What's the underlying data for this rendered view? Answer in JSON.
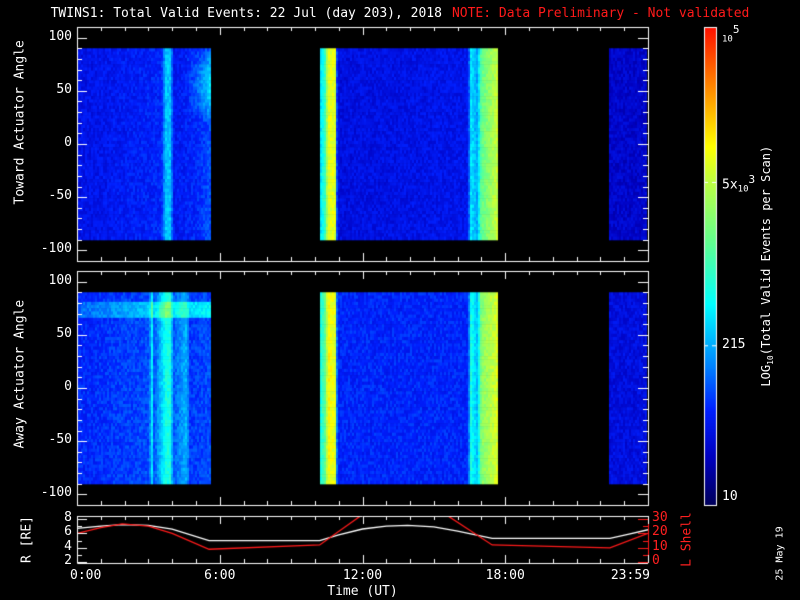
{
  "title": {
    "main": "TWINS1: Total Valid Events: 22 Jul (day 203), 2018",
    "note": "NOTE: Data Preliminary - Not validated"
  },
  "colors": {
    "note": "#ff1a1a",
    "r_line": "#ffffff",
    "l_line": "#ff1a1a",
    "axis": "#ffffff"
  },
  "chart_data": [
    {
      "type": "heatmap",
      "name": "toward",
      "ylabel": "Toward Actuator Angle",
      "ylim": [
        -110,
        110
      ],
      "yticks": [
        "100",
        "50",
        "0",
        "-50",
        "-100"
      ],
      "ytick_values": [
        100,
        50,
        0,
        -50,
        -100
      ],
      "data_angle_range": [
        -90,
        90
      ],
      "xlim_hours": [
        0,
        24
      ],
      "intervals_hours": [
        [
          0,
          5.6
        ],
        [
          10.2,
          17.7
        ],
        [
          22.35,
          23.9
        ]
      ],
      "column_profile": [
        [
          0,
          0.16
        ],
        [
          3.5,
          0.2
        ],
        [
          3.7,
          0.36
        ],
        [
          3.9,
          0.36
        ],
        [
          4.0,
          0.18
        ],
        [
          5.0,
          0.2
        ],
        [
          5.6,
          0.25
        ],
        [
          10.2,
          0.4
        ],
        [
          10.4,
          0.5
        ],
        [
          10.5,
          0.72
        ],
        [
          10.8,
          0.72
        ],
        [
          10.9,
          0.15
        ],
        [
          16.4,
          0.17
        ],
        [
          16.5,
          0.4
        ],
        [
          16.8,
          0.32
        ],
        [
          16.95,
          0.55
        ],
        [
          17.7,
          0.7
        ],
        [
          22.35,
          0.12
        ],
        [
          23.9,
          0.12
        ]
      ],
      "upper_glow": {
        "hours": [
          4.5,
          5.6
        ],
        "angle": [
          20,
          90
        ],
        "boost": 0.15
      }
    },
    {
      "type": "heatmap",
      "name": "away",
      "ylabel": "Away Actuator Angle",
      "ylim": [
        -110,
        110
      ],
      "yticks": [
        "100",
        "50",
        "0",
        "-50",
        "-100"
      ],
      "ytick_values": [
        100,
        50,
        0,
        -50,
        -100
      ],
      "data_angle_range": [
        -90,
        90
      ],
      "xlim_hours": [
        0,
        24
      ],
      "intervals_hours": [
        [
          0,
          5.6
        ],
        [
          10.2,
          17.7
        ],
        [
          22.35,
          23.9
        ]
      ],
      "column_profile": [
        [
          0,
          0.2
        ],
        [
          3.0,
          0.24
        ],
        [
          3.1,
          0.42
        ],
        [
          3.2,
          0.24
        ],
        [
          3.7,
          0.45
        ],
        [
          3.9,
          0.45
        ],
        [
          4.0,
          0.25
        ],
        [
          4.6,
          0.35
        ],
        [
          4.65,
          0.22
        ],
        [
          5.6,
          0.24
        ],
        [
          10.2,
          0.45
        ],
        [
          10.4,
          0.55
        ],
        [
          10.5,
          0.75
        ],
        [
          10.8,
          0.72
        ],
        [
          10.9,
          0.2
        ],
        [
          16.4,
          0.2
        ],
        [
          16.5,
          0.45
        ],
        [
          16.8,
          0.35
        ],
        [
          16.95,
          0.6
        ],
        [
          17.7,
          0.72
        ],
        [
          22.35,
          0.15
        ],
        [
          23.9,
          0.15
        ]
      ],
      "band": {
        "hours": [
          0,
          5.6
        ],
        "angle": [
          65,
          80
        ],
        "boost": 0.12
      }
    },
    {
      "type": "line",
      "name": "orbit",
      "ylabel": "R [RE]",
      "ylabel_right": "L Shell",
      "xlabel": "Time (UT)",
      "ylim": [
        1.9,
        8.4
      ],
      "yticks": [
        "8",
        "6",
        "4",
        "2"
      ],
      "ytick_values": [
        8,
        6,
        4,
        2
      ],
      "ylim_right": [
        -0.5,
        32
      ],
      "yticks_right": [
        "30",
        "20",
        "10",
        "0"
      ],
      "ytick_values_right": [
        30,
        20,
        10,
        0
      ],
      "xticks": [
        "0:00",
        "6:00",
        "12:00",
        "18:00",
        "23:59"
      ],
      "xtick_hours": [
        0,
        6,
        12,
        18,
        24
      ],
      "series": [
        {
          "name": "R",
          "x": [
            0,
            1,
            1.9,
            3,
            4,
            5.55,
            10.2,
            11,
            12,
            13,
            13.9,
            15,
            16,
            17.45,
            22.4,
            23.2,
            24
          ],
          "y": [
            6.7,
            7.0,
            7.2,
            7.1,
            6.6,
            5.0,
            5.0,
            5.8,
            6.6,
            7.0,
            7.1,
            6.9,
            6.3,
            5.3,
            5.3,
            5.9,
            6.5
          ]
        },
        {
          "name": "L Shell",
          "x": [
            0,
            1,
            1.9,
            3,
            4,
            5.55,
            10.2,
            12,
            15.5,
            17.45,
            22.4,
            24
          ],
          "y": [
            20,
            24,
            26.5,
            25,
            20,
            9,
            12,
            33,
            33,
            12,
            10,
            20
          ]
        }
      ]
    },
    {
      "type": "colorbar",
      "label": "LOG10(Total Valid Events per Scan)",
      "label_prefix": "LOG",
      "label_sub": "10",
      "label_rest": "(Total Valid Events per Scan)",
      "range": [
        10,
        100000
      ],
      "ticks": [
        {
          "value": 100000,
          "base": "10",
          "exp": "5",
          "prefix": ""
        },
        {
          "value": 5000,
          "base": "10",
          "exp": "3",
          "prefix": "5x"
        },
        {
          "value": 215,
          "text": "215"
        },
        {
          "value": 10,
          "text": "10"
        }
      ]
    }
  ],
  "stamp": "25 May 19"
}
